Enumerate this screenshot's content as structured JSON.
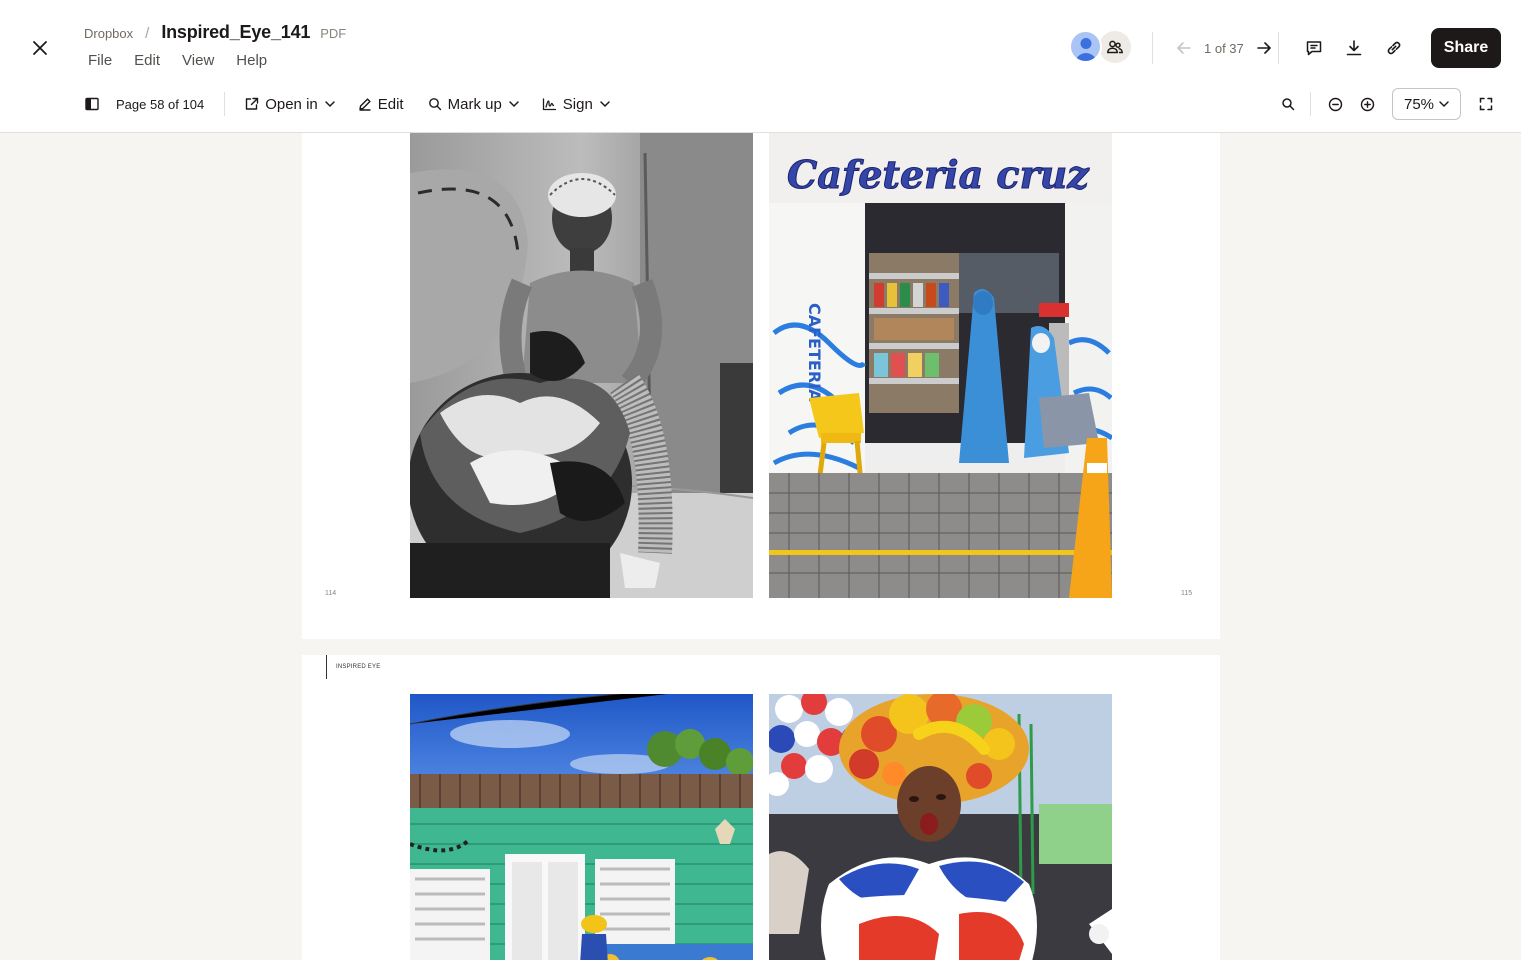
{
  "header": {
    "breadcrumb_root": "Dropbox",
    "breadcrumb_sep": "/",
    "file_name": "Inspired_Eye_141",
    "file_type": "PDF",
    "menu": [
      "File",
      "Edit",
      "View",
      "Help"
    ],
    "pager": {
      "count": "1 of 37"
    },
    "share_label": "Share"
  },
  "toolbar": {
    "page_indicator": "Page 58 of 104",
    "open_in": "Open in",
    "edit": "Edit",
    "mark_up": "Mark up",
    "sign": "Sign",
    "zoom": "75%"
  },
  "document": {
    "spread_a": {
      "folio_left": "114",
      "folio_right": "115",
      "sign_text": "Cafeteria cruz"
    },
    "spread_b": {
      "running_head": "INSPIRED EYE"
    }
  },
  "colors": {
    "share_bg": "#1e1919",
    "avatar": "#3d6fe0",
    "canvas": "#f7f5f2"
  }
}
